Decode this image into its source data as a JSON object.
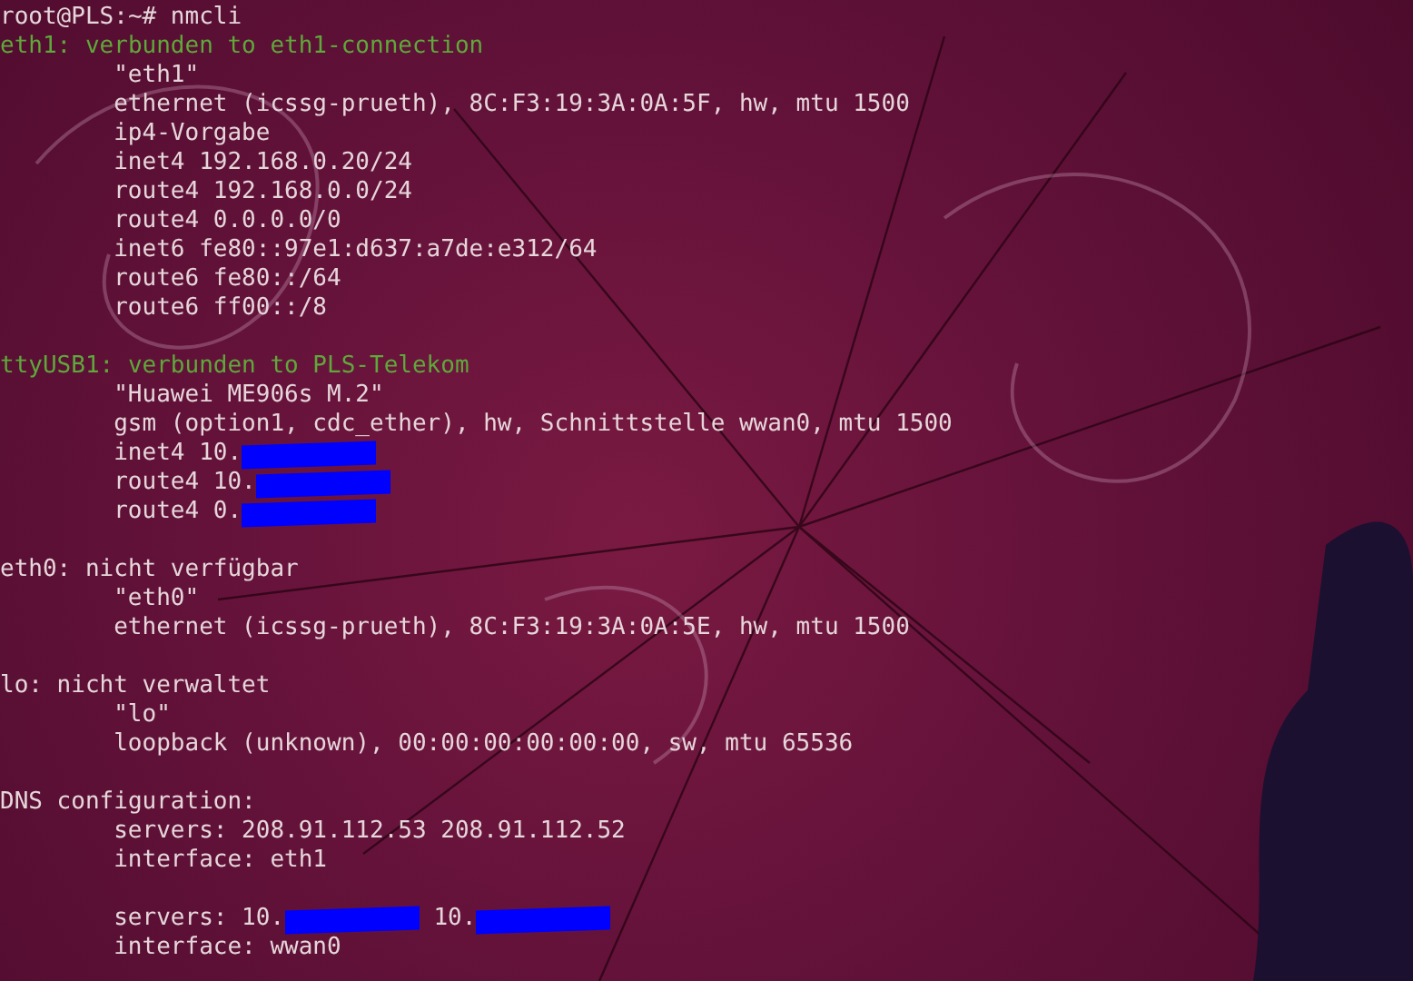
{
  "terminal": {
    "lines": [
      {
        "kind": "line",
        "parts": [
          {
            "kind": "text",
            "text": "root@PLS:~# nmcli"
          }
        ]
      },
      {
        "kind": "connected",
        "parts": [
          {
            "kind": "text",
            "text": "eth1: verbunden to eth1-connection"
          }
        ]
      },
      {
        "kind": "detail",
        "parts": [
          {
            "kind": "text",
            "text": "\"eth1\""
          }
        ]
      },
      {
        "kind": "detail",
        "parts": [
          {
            "kind": "text",
            "text": "ethernet (icssg-prueth), 8C:F3:19:3A:0A:5F, hw, mtu 1500"
          }
        ]
      },
      {
        "kind": "detail",
        "parts": [
          {
            "kind": "text",
            "text": "ip4-Vorgabe"
          }
        ]
      },
      {
        "kind": "detail",
        "parts": [
          {
            "kind": "text",
            "text": "inet4 192.168.0.20/24"
          }
        ]
      },
      {
        "kind": "detail",
        "parts": [
          {
            "kind": "text",
            "text": "route4 192.168.0.0/24"
          }
        ]
      },
      {
        "kind": "detail",
        "parts": [
          {
            "kind": "text",
            "text": "route4 0.0.0.0/0"
          }
        ]
      },
      {
        "kind": "detail",
        "parts": [
          {
            "kind": "text",
            "text": "inet6 fe80::97e1:d637:a7de:e312/64"
          }
        ]
      },
      {
        "kind": "detail",
        "parts": [
          {
            "kind": "text",
            "text": "route6 fe80::/64"
          }
        ]
      },
      {
        "kind": "detail",
        "parts": [
          {
            "kind": "text",
            "text": "route6 ff00::/8"
          }
        ]
      },
      {
        "kind": "blank"
      },
      {
        "kind": "connected",
        "parts": [
          {
            "kind": "text",
            "text": "ttyUSB1: verbunden to PLS-Telekom"
          }
        ]
      },
      {
        "kind": "detail",
        "parts": [
          {
            "kind": "text",
            "text": "\"Huawei ME906s M.2\""
          }
        ]
      },
      {
        "kind": "detail",
        "parts": [
          {
            "kind": "text",
            "text": "gsm (option1, cdc_ether), hw, Schnittstelle wwan0, mtu 1500"
          }
        ]
      },
      {
        "kind": "detail",
        "parts": [
          {
            "kind": "text",
            "text": "inet4 10."
          },
          {
            "kind": "redacted"
          }
        ]
      },
      {
        "kind": "detail",
        "parts": [
          {
            "kind": "text",
            "text": "route4 10."
          },
          {
            "kind": "redacted"
          }
        ]
      },
      {
        "kind": "detail",
        "parts": [
          {
            "kind": "text",
            "text": "route4 0."
          },
          {
            "kind": "redacted"
          }
        ]
      },
      {
        "kind": "blank"
      },
      {
        "kind": "line",
        "parts": [
          {
            "kind": "text",
            "text": "eth0: nicht verfügbar"
          }
        ]
      },
      {
        "kind": "detail",
        "parts": [
          {
            "kind": "text",
            "text": "\"eth0\""
          }
        ]
      },
      {
        "kind": "detail",
        "parts": [
          {
            "kind": "text",
            "text": "ethernet (icssg-prueth), 8C:F3:19:3A:0A:5E, hw, mtu 1500"
          }
        ]
      },
      {
        "kind": "blank"
      },
      {
        "kind": "line",
        "parts": [
          {
            "kind": "text",
            "text": "lo: nicht verwaltet"
          }
        ]
      },
      {
        "kind": "detail",
        "parts": [
          {
            "kind": "text",
            "text": "\"lo\""
          }
        ]
      },
      {
        "kind": "detail",
        "parts": [
          {
            "kind": "text",
            "text": "loopback (unknown), 00:00:00:00:00:00, sw, mtu 65536"
          }
        ]
      },
      {
        "kind": "blank"
      },
      {
        "kind": "line",
        "parts": [
          {
            "kind": "text",
            "text": "DNS configuration:"
          }
        ]
      },
      {
        "kind": "detail",
        "parts": [
          {
            "kind": "text",
            "text": "servers: 208.91.112.53 208.91.112.52"
          }
        ]
      },
      {
        "kind": "detail",
        "parts": [
          {
            "kind": "text",
            "text": "interface: eth1"
          }
        ]
      },
      {
        "kind": "blank"
      },
      {
        "kind": "detail",
        "parts": [
          {
            "kind": "text",
            "text": "servers: 10."
          },
          {
            "kind": "redacted"
          },
          {
            "kind": "text",
            "text": " 10."
          },
          {
            "kind": "redacted"
          }
        ]
      },
      {
        "kind": "detail",
        "parts": [
          {
            "kind": "text",
            "text": "interface: wwan0"
          }
        ]
      }
    ]
  }
}
